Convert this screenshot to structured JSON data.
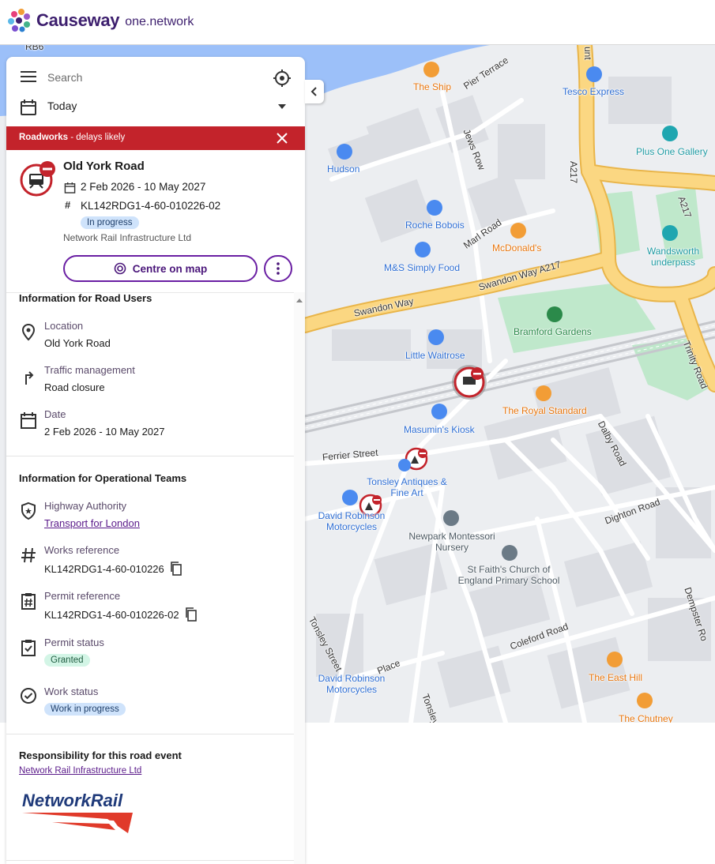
{
  "header": {
    "brand": "Causeway",
    "brand_sub": "one.network"
  },
  "search": {
    "placeholder": "Search",
    "date_filter": "Today"
  },
  "banner": {
    "type": "Roadworks",
    "suffix": " - delays likely"
  },
  "event": {
    "title": "Old York Road",
    "dates": "2 Feb 2026 - 10 May 2027",
    "reference": "KL142RDG1-4-60-010226-02",
    "status_badge": "In progress",
    "organisation": "Network Rail Infrastructure Ltd",
    "centre_button": "Centre on map"
  },
  "road_users": {
    "title": "Information for Road Users",
    "location_label": "Location",
    "location_value": "Old York Road",
    "traffic_label": "Traffic management",
    "traffic_value": "Road closure",
    "date_label": "Date",
    "date_value": "2 Feb 2026 - 10 May 2027"
  },
  "operational": {
    "title": "Information for Operational Teams",
    "highway_label": "Highway Authority",
    "highway_value": "Transport for London",
    "works_label": "Works reference",
    "works_value": "KL142RDG1-4-60-010226",
    "permit_label": "Permit reference",
    "permit_value": "KL142RDG1-4-60-010226-02",
    "permit_status_label": "Permit status",
    "permit_status_value": "Granted",
    "work_status_label": "Work status",
    "work_status_value": "Work in progress"
  },
  "responsibility": {
    "title": "Responsibility for this road event",
    "org_link": "Network Rail Infrastructure Ltd",
    "logo_text": "NetworkRail"
  },
  "map": {
    "roads": {
      "rb6": "RB6",
      "pier_terrace": "Pier Terrace",
      "jews_row": "Jews Row",
      "a217_n": "A217",
      "a217_e": "A217",
      "marl_road": "Marl Road",
      "swandon_way_a217": "Swandon Way A217",
      "swandon_way": "Swandon Way",
      "ferrier_street": "Ferrier Street",
      "dalby_road": "Dalby Road",
      "dighton_road": "Dighton Road",
      "trinity_road": "Trinity Road",
      "tonsley_street": "Tonsley Street",
      "coleford_road": "Coleford Road",
      "dempster_road": "Dempster Ro",
      "tonsley_place": "Place",
      "tonsley_hill": "Tonsley",
      "unt": "unt"
    },
    "pois": {
      "the_ship": "The Ship",
      "tesco": "Tesco Express",
      "plus_one": "Plus One Gallery",
      "hudson": "Hudson",
      "roche": "Roche Bobois",
      "mcdonalds": "McDonald's",
      "wandsworth": "Wandsworth underpass",
      "ms": "M&S Simply Food",
      "bramford": "Bramford Gardens",
      "waitrose": "Little Waitrose",
      "royal_standard": "The Royal Standard",
      "masumin": "Masumin's Kiosk",
      "tonsley_antiques": "Tonsley Antiques & Fine Art",
      "david_robinson": "David Robinson Motorcycles",
      "newpark": "Newpark Montessori Nursery",
      "st_faith": "St Faith's Church of England Primary School",
      "east_hill": "The East Hill",
      "chutney": "The Chutney",
      "david_robinson_2": "David Robinson Motorcycles"
    }
  },
  "colors": {
    "brand": "#3d1f6e",
    "accent": "#6a1fa3",
    "alert": "#c3232b",
    "water": "#9cc0f9",
    "major_road": "#fbd782",
    "park": "#bfe8cb"
  },
  "icons": [
    "menu-icon",
    "locate-icon",
    "calendar-icon",
    "close-icon",
    "roadworks-closure-icon",
    "hash-icon",
    "target-icon",
    "more-vertical-icon",
    "location-pin-icon",
    "turn-arrow-icon",
    "shield-star-icon",
    "copy-icon",
    "clipboard-hash-icon",
    "clipboard-check-icon",
    "check-circle-icon",
    "chevron-left-icon"
  ]
}
